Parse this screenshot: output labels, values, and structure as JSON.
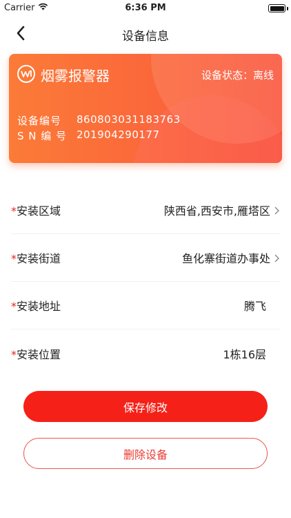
{
  "status_bar": {
    "carrier": "Carrier",
    "time": "6:36 PM",
    "battery_level": 1.0
  },
  "nav": {
    "title": "设备信息",
    "back_icon": "chevron-left-icon"
  },
  "device_card": {
    "name": "烟雾报警器",
    "status_label": "设备状态：离线",
    "number_label": "设备编号",
    "number_value": "860803031183763",
    "sn_label": "S N 编 号",
    "sn_value": "201904290177",
    "logo_icon": "device-logo-icon"
  },
  "form": {
    "required_mark": "*",
    "area": {
      "label": "安装区域",
      "value": "陕西省,西安市,雁塔区"
    },
    "street": {
      "label": "安装街道",
      "value": "鱼化寨街道办事处"
    },
    "address": {
      "label": "安装地址",
      "value": "腾飞"
    },
    "position": {
      "label": "安装位置",
      "value": "1栋16层"
    }
  },
  "actions": {
    "save_label": "保存修改",
    "delete_label": "删除设备"
  },
  "colors": {
    "primary": "#f52118",
    "card_start": "#fb7b38",
    "card_end": "#f9533e",
    "required": "#e8251d"
  }
}
